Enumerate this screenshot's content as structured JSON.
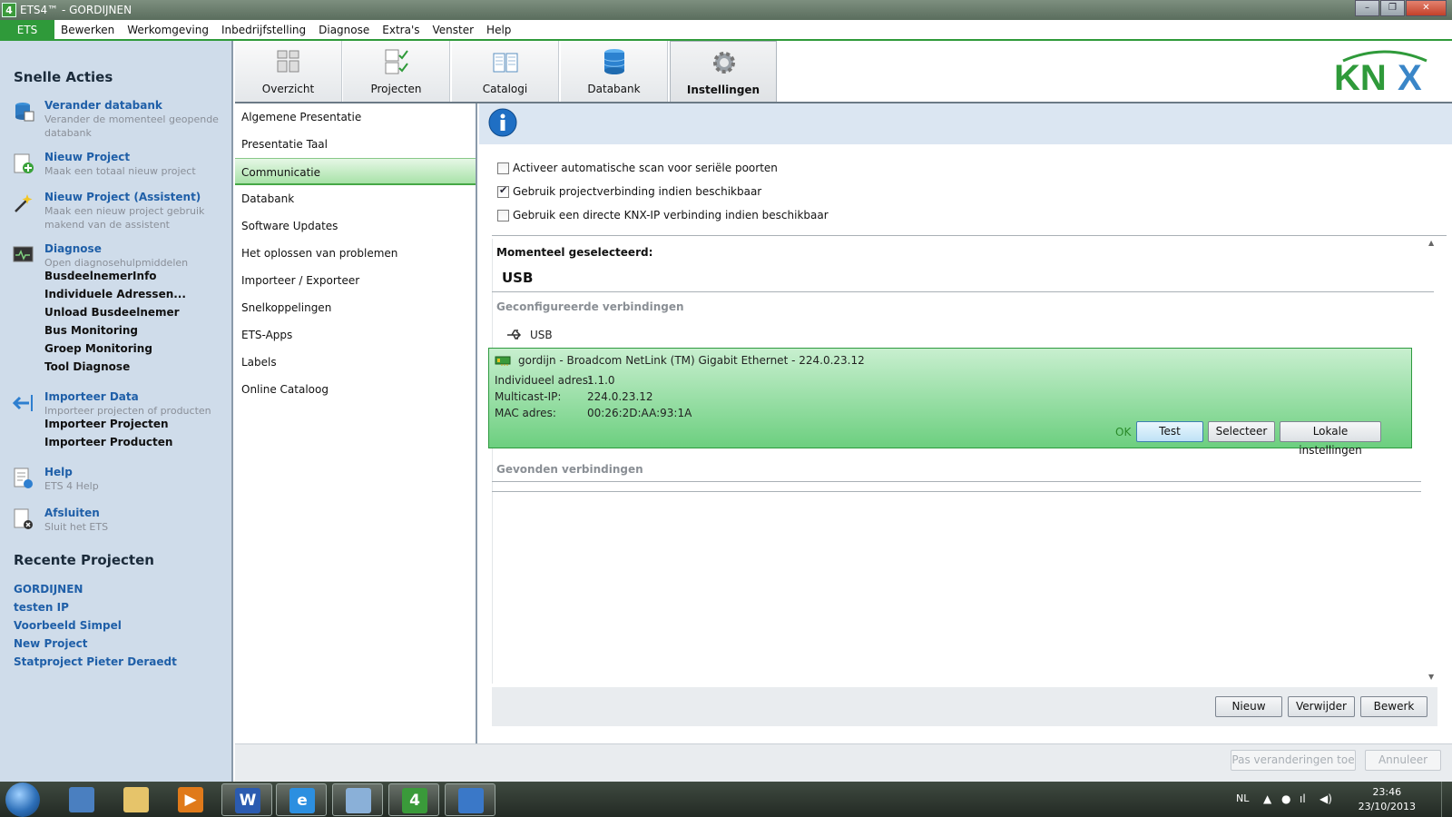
{
  "window": {
    "app_icon": "4",
    "title": "ETS4™ - GORDIJNEN",
    "controls": [
      "–",
      "❐",
      "✕"
    ]
  },
  "menu": {
    "ets": "ETS",
    "items": [
      "Bewerken",
      "Werkomgeving",
      "Inbedrijfstelling",
      "Diagnose",
      "Extra's",
      "Venster",
      "Help"
    ]
  },
  "sidebar": {
    "quick_actions_title": "Snelle Acties",
    "actions": [
      {
        "title": "Verander databank",
        "desc": "Verander de momenteel geopende databank",
        "icon": "database-icon"
      },
      {
        "title": "Nieuw Project",
        "desc": "Maak een totaal nieuw project",
        "icon": "new-project-icon"
      },
      {
        "title": "Nieuw Project (Assistent)",
        "desc": "Maak een nieuw project gebruik makend van de assistent",
        "icon": "wizard-icon"
      },
      {
        "title": "Diagnose",
        "desc": "Open diagnosehulpmiddelen",
        "icon": "diagnose-icon"
      },
      {
        "title": "Importeer Data",
        "desc": "Importeer projecten of producten",
        "icon": "import-arrow-icon"
      },
      {
        "title": "Help",
        "desc": "ETS 4 Help",
        "icon": "help-icon"
      },
      {
        "title": "Afsluiten",
        "desc": "Sluit het ETS",
        "icon": "exit-icon"
      }
    ],
    "diagnose_items": [
      "BusdeelnemerInfo",
      "Individuele Adressen...",
      "Unload Busdeelnemer",
      "Bus Monitoring",
      "Groep Monitoring",
      "Tool Diagnose"
    ],
    "import_items": [
      "Importeer Projecten",
      "Importeer Producten"
    ],
    "recent_title": "Recente Projecten",
    "recent": [
      "GORDIJNEN",
      "testen IP",
      "Voorbeeld Simpel",
      "New Project",
      "Statproject Pieter Deraedt"
    ]
  },
  "ribbon": {
    "tabs": [
      "Overzicht",
      "Projecten",
      "Catalogi",
      "Databank",
      "Instellingen"
    ],
    "active_tab": "Instellingen",
    "logo": "KNX",
    "logo_color": "#2f9a3a",
    "logo_x_color": "#3a86c8"
  },
  "settings_nav": {
    "items": [
      "Algemene Presentatie",
      "Presentatie Taal",
      "Communicatie",
      "Databank",
      "Software Updates",
      "Het oplossen van problemen",
      "Importeer / Exporteer",
      "Snelkoppelingen",
      "ETS-Apps",
      "Labels",
      "Online Cataloog"
    ],
    "selected": "Communicatie"
  },
  "communication": {
    "options": [
      {
        "label": "Activeer automatische scan voor seriële poorten",
        "checked": false
      },
      {
        "label": "Gebruik projectverbinding indien beschikbaar",
        "checked": true
      },
      {
        "label": "Gebruik een directe KNX-IP verbinding indien beschikbaar",
        "checked": false
      }
    ],
    "current_label": "Momenteel geselecteerd:",
    "current_value": "USB",
    "configured_title": "Geconfigureerde verbindingen",
    "usb_label": "USB",
    "connection": {
      "title": "gordijn - Broadcom NetLink (TM) Gigabit Ethernet - 224.0.23.12",
      "fields": [
        {
          "label": "Individueel adres:",
          "value": "1.1.0"
        },
        {
          "label": "Multicast-IP:",
          "value": "224.0.23.12"
        },
        {
          "label": "MAC adres:",
          "value": "00:26:2D:AA:93:1A"
        }
      ],
      "status": "OK",
      "buttons": [
        "Test",
        "Selecteer",
        "Lokale instellingen"
      ]
    },
    "found_title": "Gevonden verbindingen",
    "bottom_buttons": [
      "Nieuw",
      "Verwijder",
      "Bewerk"
    ]
  },
  "footer": {
    "apply": "Pas veranderingen toe",
    "cancel": "Annuleer"
  },
  "taskbar": {
    "lang": "NL",
    "time": "23:46",
    "date": "23/10/2013"
  }
}
